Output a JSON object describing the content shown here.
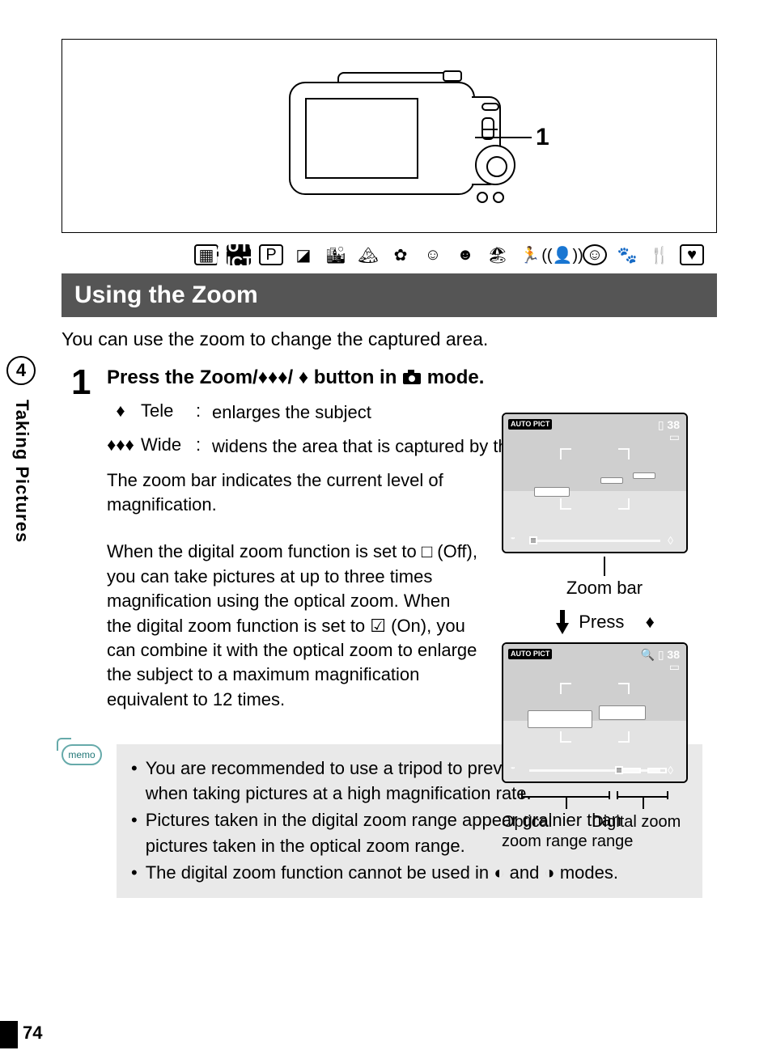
{
  "page_number": "74",
  "chapter": {
    "number": "4",
    "title": "Taking Pictures"
  },
  "illustration": {
    "callout": "1"
  },
  "mode_icons": [
    "grid-icon",
    "auto-pict-icon",
    "p-icon",
    "scene-icon",
    "night-group-icon",
    "landscape-icon",
    "flower-icon",
    "portrait-icon",
    "kids-icon",
    "surf-icon",
    "sport-icon",
    "shake-reduce-icon",
    "face-icon",
    "pet-icon",
    "food-icon",
    "frame-icon"
  ],
  "section_title": "Using the Zoom",
  "intro": "You can use the zoom to change the captured area.",
  "step": {
    "number": "1",
    "heading_pre": "Press the Zoom/",
    "heading_mid": "/",
    "heading_post": " button in ",
    "heading_end": " mode.",
    "tele": {
      "label": "Tele",
      "desc": "enlarges the subject"
    },
    "wide": {
      "label": "Wide",
      "desc": "widens the area that is captured by the camera"
    },
    "bar_text": "The zoom bar indicates the current level of magnification.",
    "digital_text": "When the digital zoom function is set to □ (Off), you can take pictures at up to three times magnification using the optical zoom. When the digital zoom function is set to ☑ (On), you can combine it with the optical zoom to enlarge the subject to a maximum magnification equivalent to 12 times."
  },
  "screen": {
    "badge": "AUTO\nPICT",
    "shots": "38",
    "zoom_bar_label": "Zoom bar",
    "press_label": "Press",
    "optical_label": "Optical zoom range",
    "digital_label": "Digital zoom range"
  },
  "memo": {
    "label": "memo",
    "items": [
      "You are recommended to use a tripod to prevent camera shake when taking pictures at a high magnification rate.",
      "Pictures taken in the digital zoom range appear grainier than pictures taken in the optical zoom range.",
      "The digital zoom function cannot be used in ◐ and ◑ modes."
    ]
  }
}
